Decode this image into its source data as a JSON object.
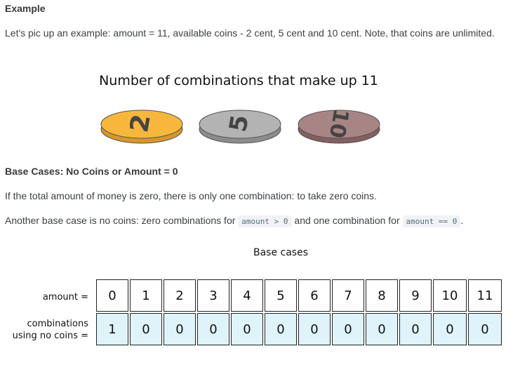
{
  "example": {
    "heading": "Example",
    "text": "Let's pic up an example: amount = 11, available coins - 2 cent, 5 cent and 10 cent. Note, that coins are unlimited."
  },
  "figure1": {
    "title": "Number of combinations that make up 11",
    "coins": [
      {
        "label": "2",
        "color": "#f6b73c",
        "edge": "#d9962a"
      },
      {
        "label": "5",
        "color": "#b3b3b3",
        "edge": "#8c8c8c"
      },
      {
        "label": "10",
        "color": "#a88585",
        "edge": "#855f5f"
      }
    ]
  },
  "base_cases": {
    "heading": "Base Cases: No Coins or Amount = 0",
    "text1": "If the total amount of money is zero, there is only one combination: to take zero coins.",
    "text2_a": "Another base case is no coins: zero combinations for ",
    "code1": "amount > 0",
    "text2_b": " and one combination for ",
    "code2": "amount == 0",
    "text2_c": "."
  },
  "figure2": {
    "title": "Base cases",
    "amount_label": "amount =",
    "comb_label_line1": "combinations",
    "comb_label_line2": "using no coins =",
    "amounts": [
      "0",
      "1",
      "2",
      "3",
      "4",
      "5",
      "6",
      "7",
      "8",
      "9",
      "10",
      "11"
    ],
    "combinations": [
      "1",
      "0",
      "0",
      "0",
      "0",
      "0",
      "0",
      "0",
      "0",
      "0",
      "0",
      "0"
    ],
    "cell_color": "#dff3fa"
  }
}
